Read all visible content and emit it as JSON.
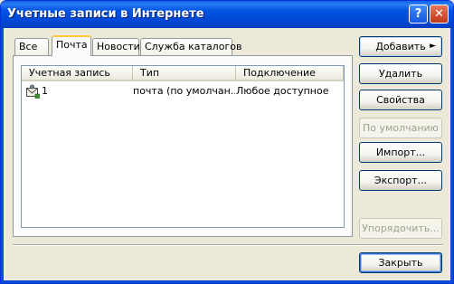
{
  "window": {
    "title": "Учетные записи в Интернете",
    "help_label": "?",
    "close_label": "✕"
  },
  "tabs": [
    {
      "label": "Все",
      "active": false
    },
    {
      "label": "Почта",
      "active": true
    },
    {
      "label": "Новости",
      "active": false
    },
    {
      "label": "Служба каталогов",
      "active": false
    }
  ],
  "accounts_list": {
    "columns": [
      "Учетная запись",
      "Тип",
      "Подключение"
    ],
    "rows": [
      {
        "account": "1",
        "type": "почта (по умолчан...",
        "connection": "Любое доступное",
        "icon": "mail-account-icon"
      }
    ]
  },
  "buttons": {
    "add": {
      "label": "Добавить",
      "arrow": "►"
    },
    "remove": {
      "label": "Удалить"
    },
    "properties": {
      "label": "Свойства"
    },
    "set_default": {
      "label": "По умолчанию"
    },
    "import": {
      "label": "Импорт..."
    },
    "export": {
      "label": "Экспорт..."
    },
    "order": {
      "label": "Упорядочить..."
    },
    "close": {
      "label": "Закрыть"
    }
  },
  "colors": {
    "titlebar": "#0054e3",
    "dialog_bg": "#ece9d8",
    "tab_highlight": "#ffc73c"
  }
}
